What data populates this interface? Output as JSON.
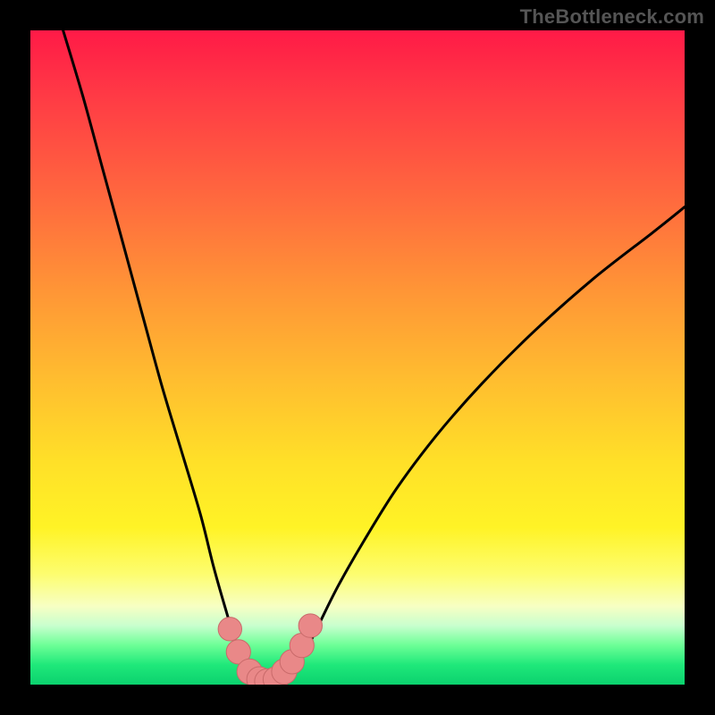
{
  "attribution": "TheBottleneck.com",
  "colors": {
    "frame": "#000000",
    "curve": "#000000",
    "marker_fill": "#e98888",
    "marker_stroke": "#c96a6a",
    "gradient_stops": [
      "#ff1a47",
      "#ff3a45",
      "#ff6a3e",
      "#ff9636",
      "#ffbf2f",
      "#ffe028",
      "#fff326",
      "#fdfd6e",
      "#f7ffc3",
      "#c8ffce",
      "#6cff96",
      "#1fe87a",
      "#0bd26e"
    ]
  },
  "chart_data": {
    "type": "line",
    "title": "",
    "xlabel": "",
    "ylabel": "",
    "xlim": [
      0,
      100
    ],
    "ylim": [
      0,
      100
    ],
    "note": "V-shaped bottleneck curve; y≈0 near x≈33–40, steep left arm, shallower right arm. Axes unlabeled; values read as percentage of plot extent.",
    "series": [
      {
        "name": "bottleneck-curve",
        "x": [
          5,
          8,
          11,
          14,
          17,
          20,
          23,
          26,
          28,
          30,
          31.5,
          33,
          35,
          37,
          39,
          40.5,
          42,
          44,
          47,
          51,
          56,
          62,
          69,
          77,
          86,
          95,
          100
        ],
        "y": [
          100,
          90,
          79,
          68,
          57,
          46,
          36,
          26,
          18,
          11,
          6,
          2.5,
          0.8,
          0.3,
          0.8,
          2.5,
          5,
          9,
          15,
          22,
          30,
          38,
          46,
          54,
          62,
          69,
          73
        ]
      }
    ],
    "markers": {
      "name": "highlight-points",
      "x": [
        30.5,
        31.8,
        33.5,
        35,
        36.2,
        37.5,
        38.8,
        40,
        41.5,
        42.8
      ],
      "y": [
        8.5,
        5,
        2,
        0.8,
        0.5,
        0.8,
        2,
        3.5,
        6,
        9
      ],
      "r": [
        1.8,
        1.9,
        2.0,
        2.0,
        2.0,
        2.0,
        2.0,
        1.9,
        1.9,
        1.8
      ]
    }
  }
}
